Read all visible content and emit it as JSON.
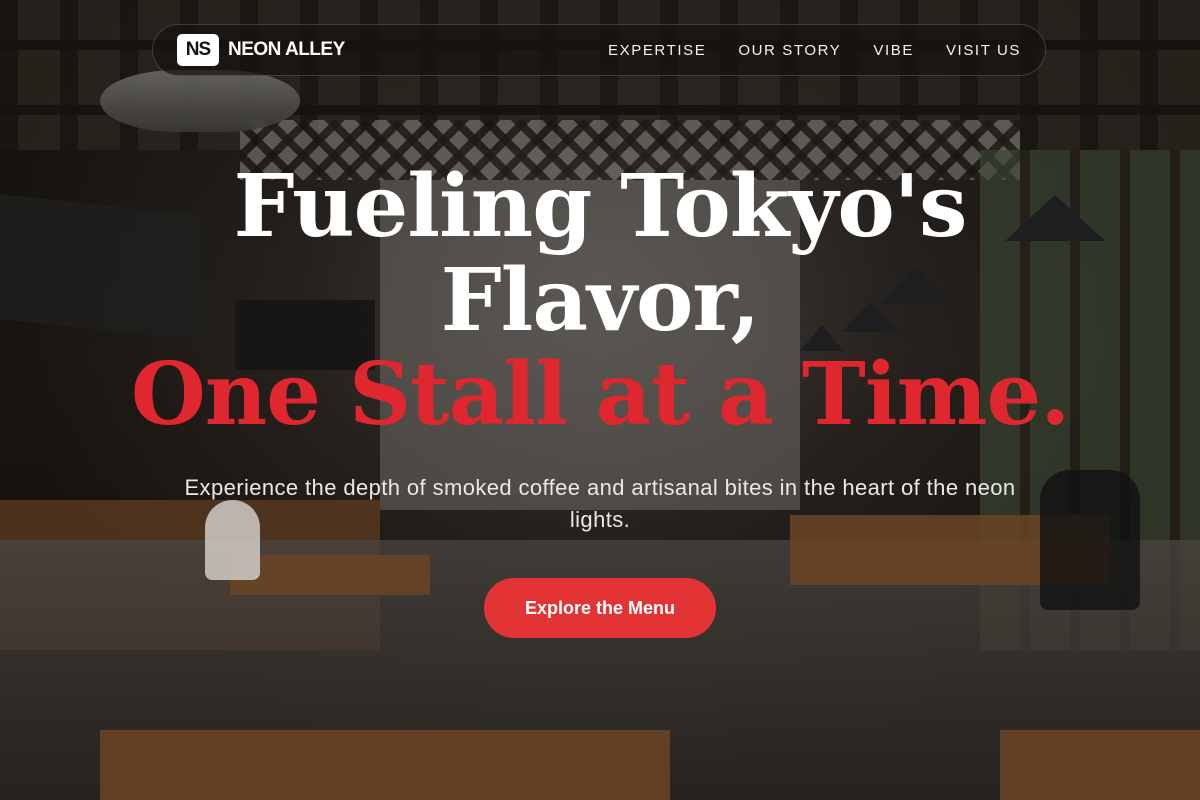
{
  "nav": {
    "logo_mark": "NS",
    "brand_name": "NEON ALLEY",
    "links": [
      "EXPERTISE",
      "OUR STORY",
      "VIBE",
      "VISIT US"
    ]
  },
  "hero": {
    "headline_line1": "Fueling Tokyo's",
    "headline_line2": "Flavor,",
    "headline_accent": "One Stall at a Time.",
    "subtitle": "Experience the depth of smoked coffee and artisanal bites in the heart of the neon lights.",
    "cta_label": "Explore the Menu"
  },
  "colors": {
    "accent": "#e0262e",
    "cta_background": "#e23434",
    "nav_background": "#16120f",
    "text": "#ffffff"
  }
}
